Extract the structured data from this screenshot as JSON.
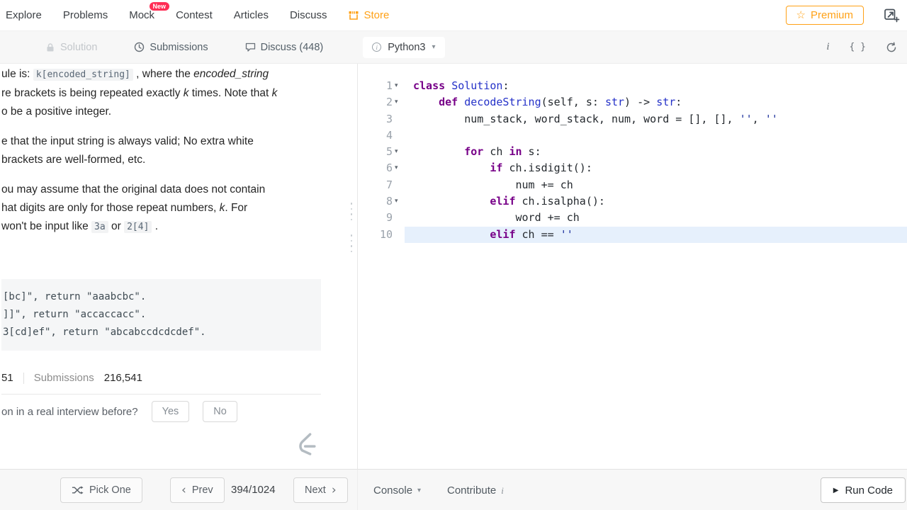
{
  "colors": {
    "accent_orange": "#ffa116",
    "badge_red": "#ff2d55",
    "line_highlight": "#e6f0fc",
    "keyword_purple": "#770088",
    "name_blue": "#2431c8",
    "string_navy": "#1c2f9c"
  },
  "topnav": {
    "items": [
      "Explore",
      "Problems",
      "Mock",
      "Contest",
      "Articles",
      "Discuss"
    ],
    "mock_badge": "New",
    "store": "Store",
    "premium": "Premium"
  },
  "toolbar": {
    "solution": "Solution",
    "submissions": "Submissions",
    "discuss": "Discuss (448)",
    "language": "Python3"
  },
  "problem": {
    "paragraphs": [
      [
        [
          {
            "t": "ule is: ",
            "s": "p"
          },
          {
            "t": "k[encoded_string]",
            "s": "c"
          },
          {
            "t": " , where the ",
            "s": "p"
          },
          {
            "t": "encoded_string",
            "s": "i"
          }
        ],
        [
          {
            "t": "re brackets is being repeated exactly ",
            "s": "p"
          },
          {
            "t": "k",
            "s": "i"
          },
          {
            "t": " times. Note that ",
            "s": "p"
          },
          {
            "t": "k",
            "s": "i"
          }
        ],
        [
          {
            "t": "o be a positive integer.",
            "s": "p"
          }
        ]
      ],
      [
        [
          {
            "t": "e that the input string is always valid; No extra white",
            "s": "p"
          }
        ],
        [
          {
            "t": "brackets are well-formed, etc.",
            "s": "p"
          }
        ]
      ],
      [
        [
          {
            "t": "ou may assume that the original data does not contain",
            "s": "p"
          }
        ],
        [
          {
            "t": "hat digits are only for those repeat numbers, ",
            "s": "p"
          },
          {
            "t": "k",
            "s": "i"
          },
          {
            "t": ". For",
            "s": "p"
          }
        ],
        [
          {
            "t": "won't be input like ",
            "s": "p"
          },
          {
            "t": "3a",
            "s": "c"
          },
          {
            "t": " or ",
            "s": "p"
          },
          {
            "t": "2[4]",
            "s": "c"
          },
          {
            "t": " .",
            "s": "p"
          }
        ]
      ]
    ],
    "example_lines": [
      "[bc]\", return \"aaabcbc\".",
      "]]\", return \"accaccacc\".",
      "3[cd]ef\", return \"abcabccdcdcdef\"."
    ],
    "stats": {
      "accepted_tail": "51",
      "submissions_label": "Submissions",
      "submissions_value": "216,541"
    },
    "interview_question": "on in a real interview before?",
    "yes": "Yes",
    "no": "No"
  },
  "editor": {
    "lines": [
      {
        "n": 1,
        "fold": true,
        "tokens": [
          {
            "t": "class",
            "s": "k"
          },
          {
            "t": " ",
            "s": "p"
          },
          {
            "t": "Solution",
            "s": "n"
          },
          {
            "t": ":",
            "s": "p"
          }
        ]
      },
      {
        "n": 2,
        "fold": true,
        "tokens": [
          {
            "t": "    ",
            "s": "p"
          },
          {
            "t": "def",
            "s": "k"
          },
          {
            "t": " ",
            "s": "p"
          },
          {
            "t": "decodeString",
            "s": "n"
          },
          {
            "t": "(self, s: ",
            "s": "p"
          },
          {
            "t": "str",
            "s": "n"
          },
          {
            "t": ") -> ",
            "s": "p"
          },
          {
            "t": "str",
            "s": "n"
          },
          {
            "t": ":",
            "s": "p"
          }
        ]
      },
      {
        "n": 3,
        "fold": false,
        "tokens": [
          {
            "t": "        num_stack, word_stack, num, word = [], [], ",
            "s": "p"
          },
          {
            "t": "''",
            "s": "s"
          },
          {
            "t": ", ",
            "s": "p"
          },
          {
            "t": "''",
            "s": "s"
          }
        ]
      },
      {
        "n": 4,
        "fold": false,
        "tokens": []
      },
      {
        "n": 5,
        "fold": true,
        "tokens": [
          {
            "t": "        ",
            "s": "p"
          },
          {
            "t": "for",
            "s": "k"
          },
          {
            "t": " ch ",
            "s": "p"
          },
          {
            "t": "in",
            "s": "k"
          },
          {
            "t": " s:",
            "s": "p"
          }
        ]
      },
      {
        "n": 6,
        "fold": true,
        "tokens": [
          {
            "t": "            ",
            "s": "p"
          },
          {
            "t": "if",
            "s": "k"
          },
          {
            "t": " ch.isdigit():",
            "s": "p"
          }
        ]
      },
      {
        "n": 7,
        "fold": false,
        "tokens": [
          {
            "t": "                num += ch",
            "s": "p"
          }
        ]
      },
      {
        "n": 8,
        "fold": true,
        "tokens": [
          {
            "t": "            ",
            "s": "p"
          },
          {
            "t": "elif",
            "s": "k"
          },
          {
            "t": " ch.isalpha():",
            "s": "p"
          }
        ]
      },
      {
        "n": 9,
        "fold": false,
        "tokens": [
          {
            "t": "                word += ch",
            "s": "p"
          }
        ]
      },
      {
        "n": 10,
        "fold": false,
        "active": true,
        "tokens": [
          {
            "t": "            ",
            "s": "p"
          },
          {
            "t": "elif",
            "s": "k"
          },
          {
            "t": " ch == ",
            "s": "p"
          },
          {
            "t": "''",
            "s": "s"
          }
        ]
      }
    ]
  },
  "bottombar": {
    "pick_one": "Pick One",
    "prev": "Prev",
    "counter": "394/1024",
    "next": "Next",
    "console": "Console",
    "contribute": "Contribute",
    "run_code": "Run Code"
  }
}
